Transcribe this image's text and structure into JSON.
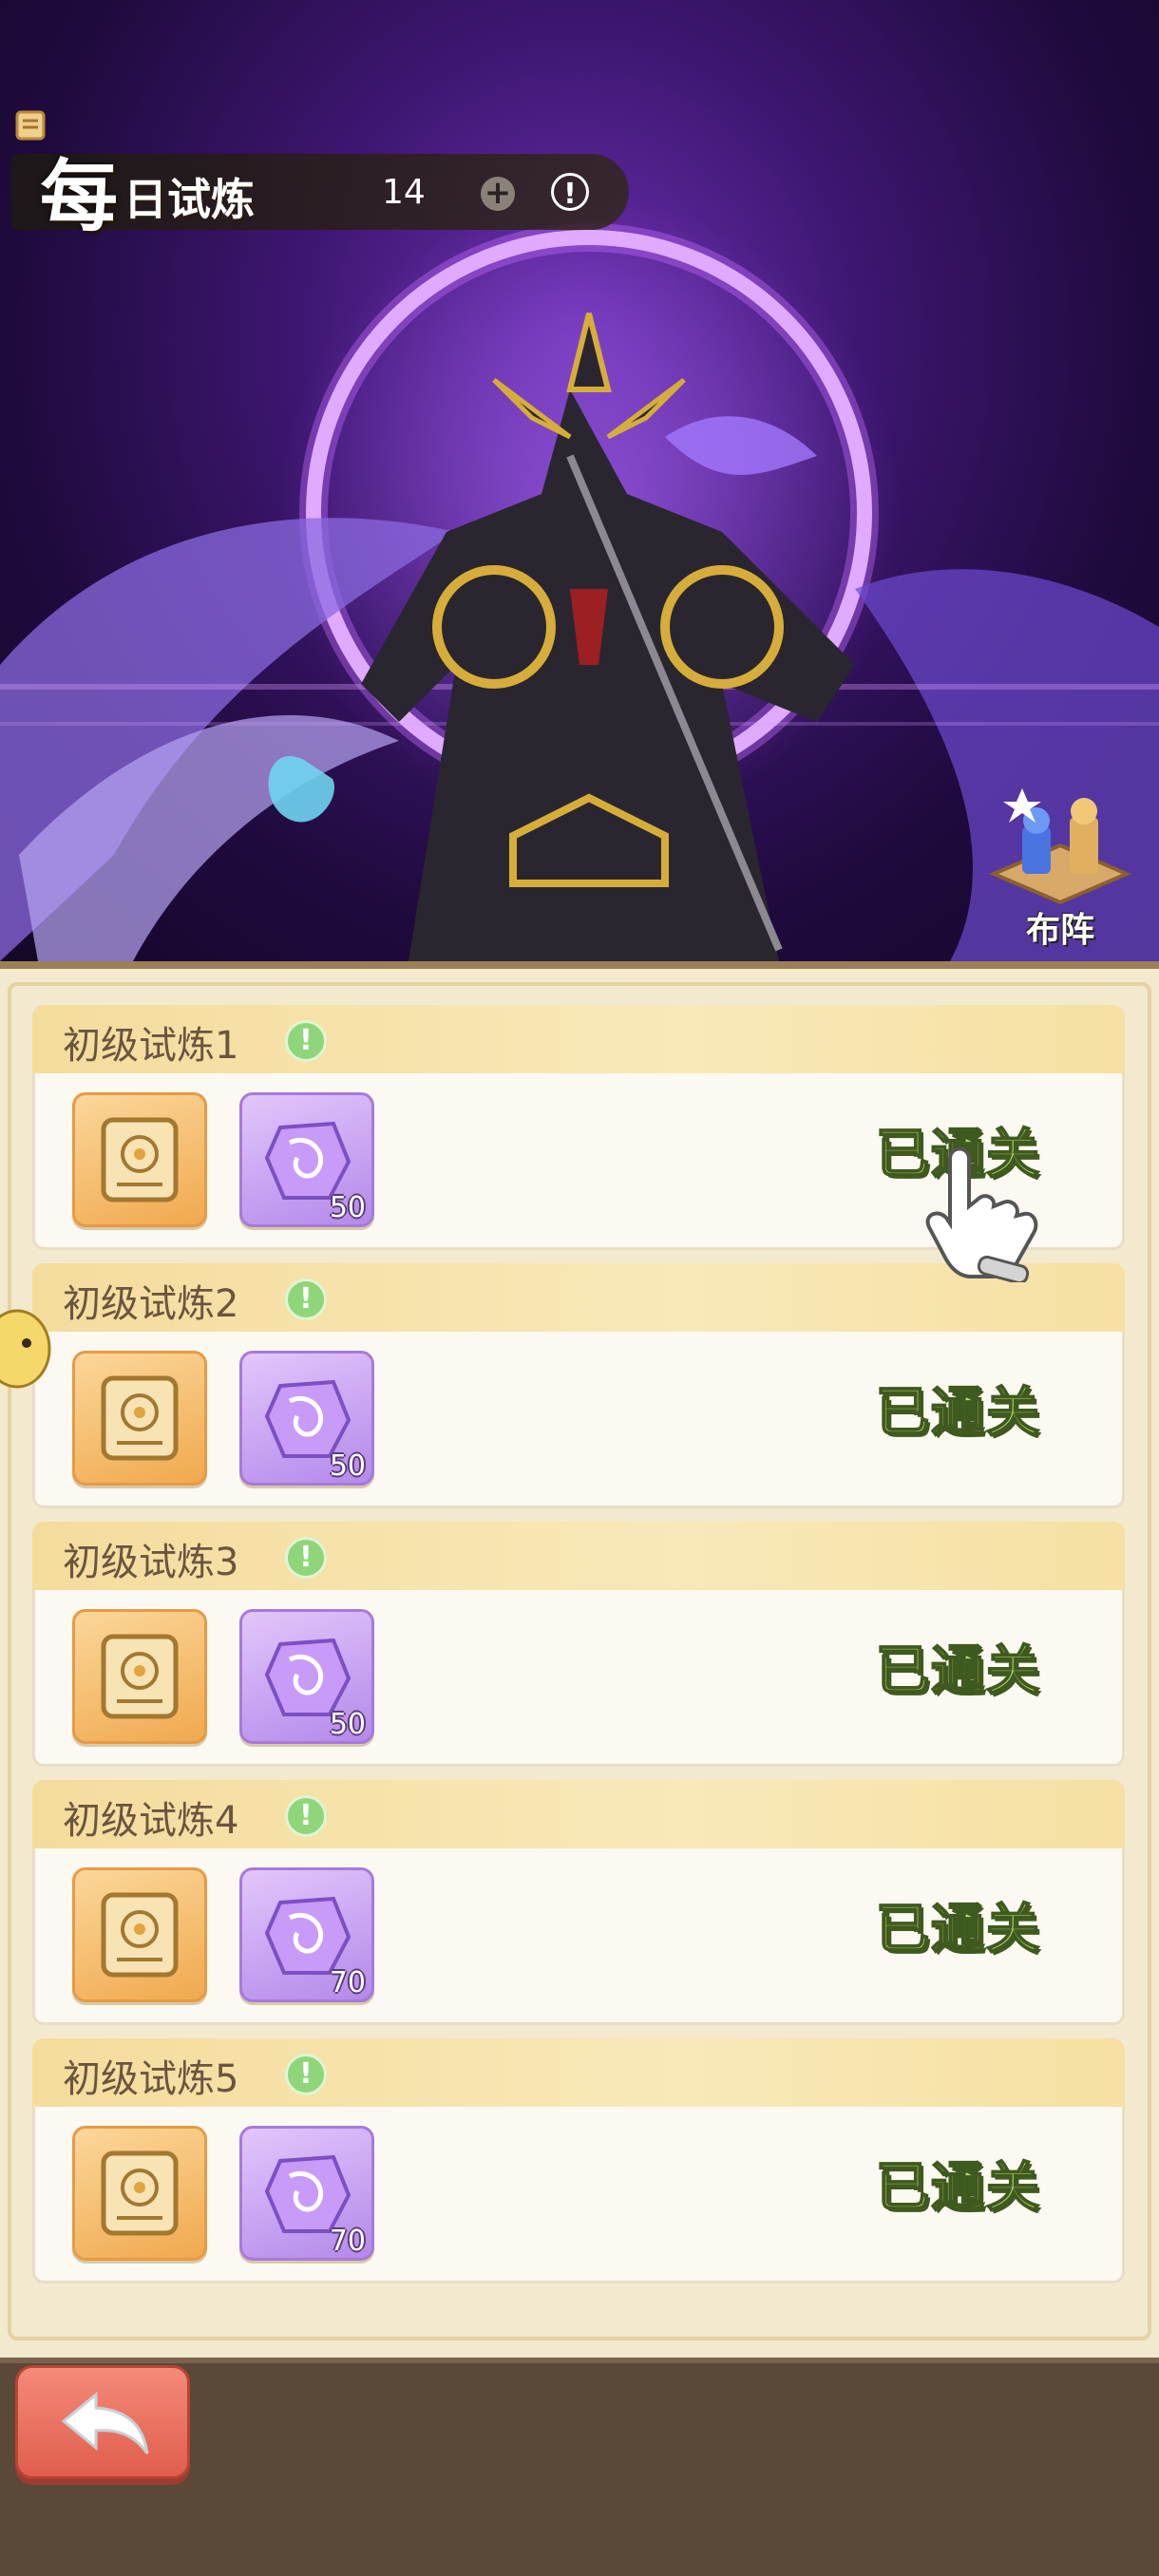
{
  "header": {
    "title_big": "每",
    "title_small": "日试炼",
    "ticket_icon": "scroll-ticket-icon",
    "ticket_count": "14",
    "plus_label": "+",
    "info_label": "!"
  },
  "formation": {
    "label": "布阵",
    "icon": "chess-pieces-icon"
  },
  "trials": [
    {
      "title": "初级试炼1",
      "reward_scroll": "scroll-reward-icon",
      "reward_gem_qty": "50",
      "status": "已通关"
    },
    {
      "title": "初级试炼2",
      "reward_scroll": "scroll-reward-icon",
      "reward_gem_qty": "50",
      "status": "已通关"
    },
    {
      "title": "初级试炼3",
      "reward_scroll": "scroll-reward-icon",
      "reward_gem_qty": "50",
      "status": "已通关"
    },
    {
      "title": "初级试炼4",
      "reward_scroll": "scroll-reward-icon",
      "reward_gem_qty": "70",
      "status": "已通关"
    },
    {
      "title": "初级试炼5",
      "reward_scroll": "scroll-reward-icon",
      "reward_gem_qty": "70",
      "status": "已通关"
    }
  ],
  "colors": {
    "accent_purple": "#6a2fb0",
    "status_green": "#b9e06f",
    "back_button": "#e05e4c",
    "panel_bg": "#f3e9cf"
  }
}
